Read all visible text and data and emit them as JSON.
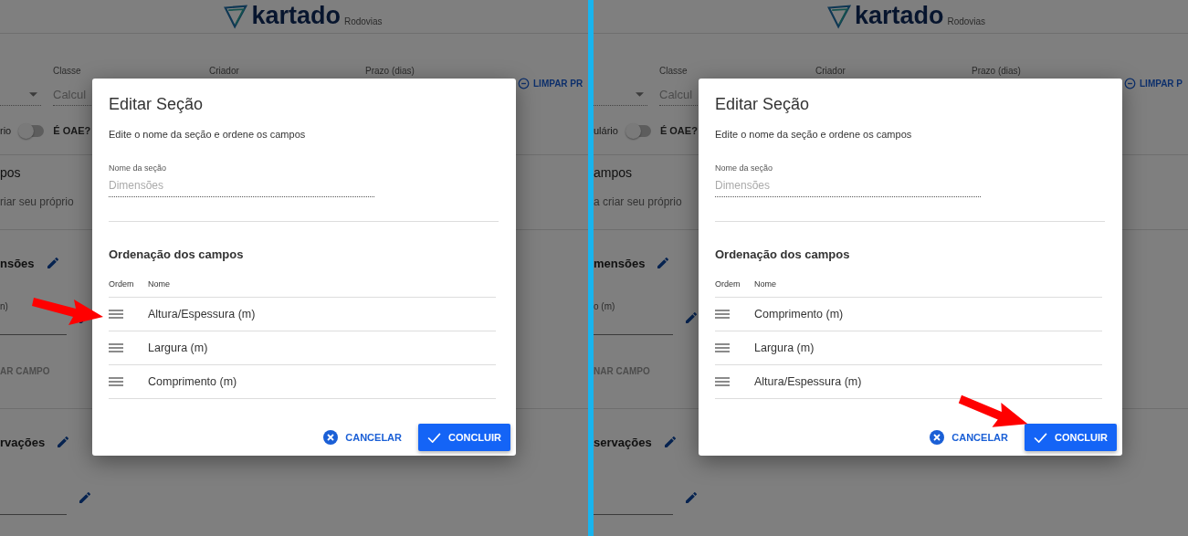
{
  "panels": [
    {
      "header": {
        "logo": "kartado",
        "logo_sub": "Rodovias"
      },
      "form": {
        "classe_label": "Classe",
        "classe_value": "Calcul",
        "criador_label": "Criador",
        "prazo_label": "Prazo (dias)",
        "clear_button": "LIMPAR PR",
        "toggle_text": "rio",
        "toggle_on": false,
        "oae_label": "É OAE?"
      },
      "fields_intro": {
        "title": "pos",
        "hint": "riar seu próprio"
      },
      "sections": [
        {
          "title": "nsões",
          "field_label": "n)",
          "add_field": "AR CAMPO"
        },
        {
          "title": "rvações"
        }
      ],
      "dialog": {
        "title": "Editar Seção",
        "subtitle": "Edite o nome da seção e ordene os campos",
        "name_label": "Nome da seção",
        "name_placeholder": "Dimensões",
        "order_title": "Ordenação dos campos",
        "columns": [
          "Ordem",
          "Nome"
        ],
        "rows": [
          {
            "name": "Altura/Espessura (m)",
            "arrow": true
          },
          {
            "name": "Largura (m)",
            "arrow": false
          },
          {
            "name": "Comprimento (m)",
            "arrow": false
          }
        ],
        "cancel": "CANCELAR",
        "confirm": "CONCLUIR",
        "confirm_arrow": false
      }
    },
    {
      "header": {
        "logo": "kartado",
        "logo_sub": "Rodovias"
      },
      "form": {
        "classe_label": "Classe",
        "classe_value": "Calcul",
        "criador_label": "Criador",
        "prazo_label": "Prazo (dias)",
        "clear_button": "LIMPAR P",
        "toggle_text": "ulário",
        "toggle_on": false,
        "oae_label": "É OAE?"
      },
      "fields_intro": {
        "title": "ampos",
        "hint": "a criar seu próprio"
      },
      "sections": [
        {
          "title": "mensões",
          "field_label": "o (m)",
          "add_field": "NAR CAMPO"
        },
        {
          "title": "servações"
        }
      ],
      "dialog": {
        "title": "Editar Seção",
        "subtitle": "Edite o nome da seção e ordene os campos",
        "name_label": "Nome da seção",
        "name_placeholder": "Dimensões",
        "order_title": "Ordenação dos campos",
        "columns": [
          "Ordem",
          "Nome"
        ],
        "rows": [
          {
            "name": "Comprimento (m)",
            "arrow": false
          },
          {
            "name": "Largura (m)",
            "arrow": false
          },
          {
            "name": "Altura/Espessura (m)",
            "arrow": false
          }
        ],
        "cancel": "CANCELAR",
        "confirm": "CONCLUIR",
        "confirm_arrow": true
      }
    }
  ]
}
